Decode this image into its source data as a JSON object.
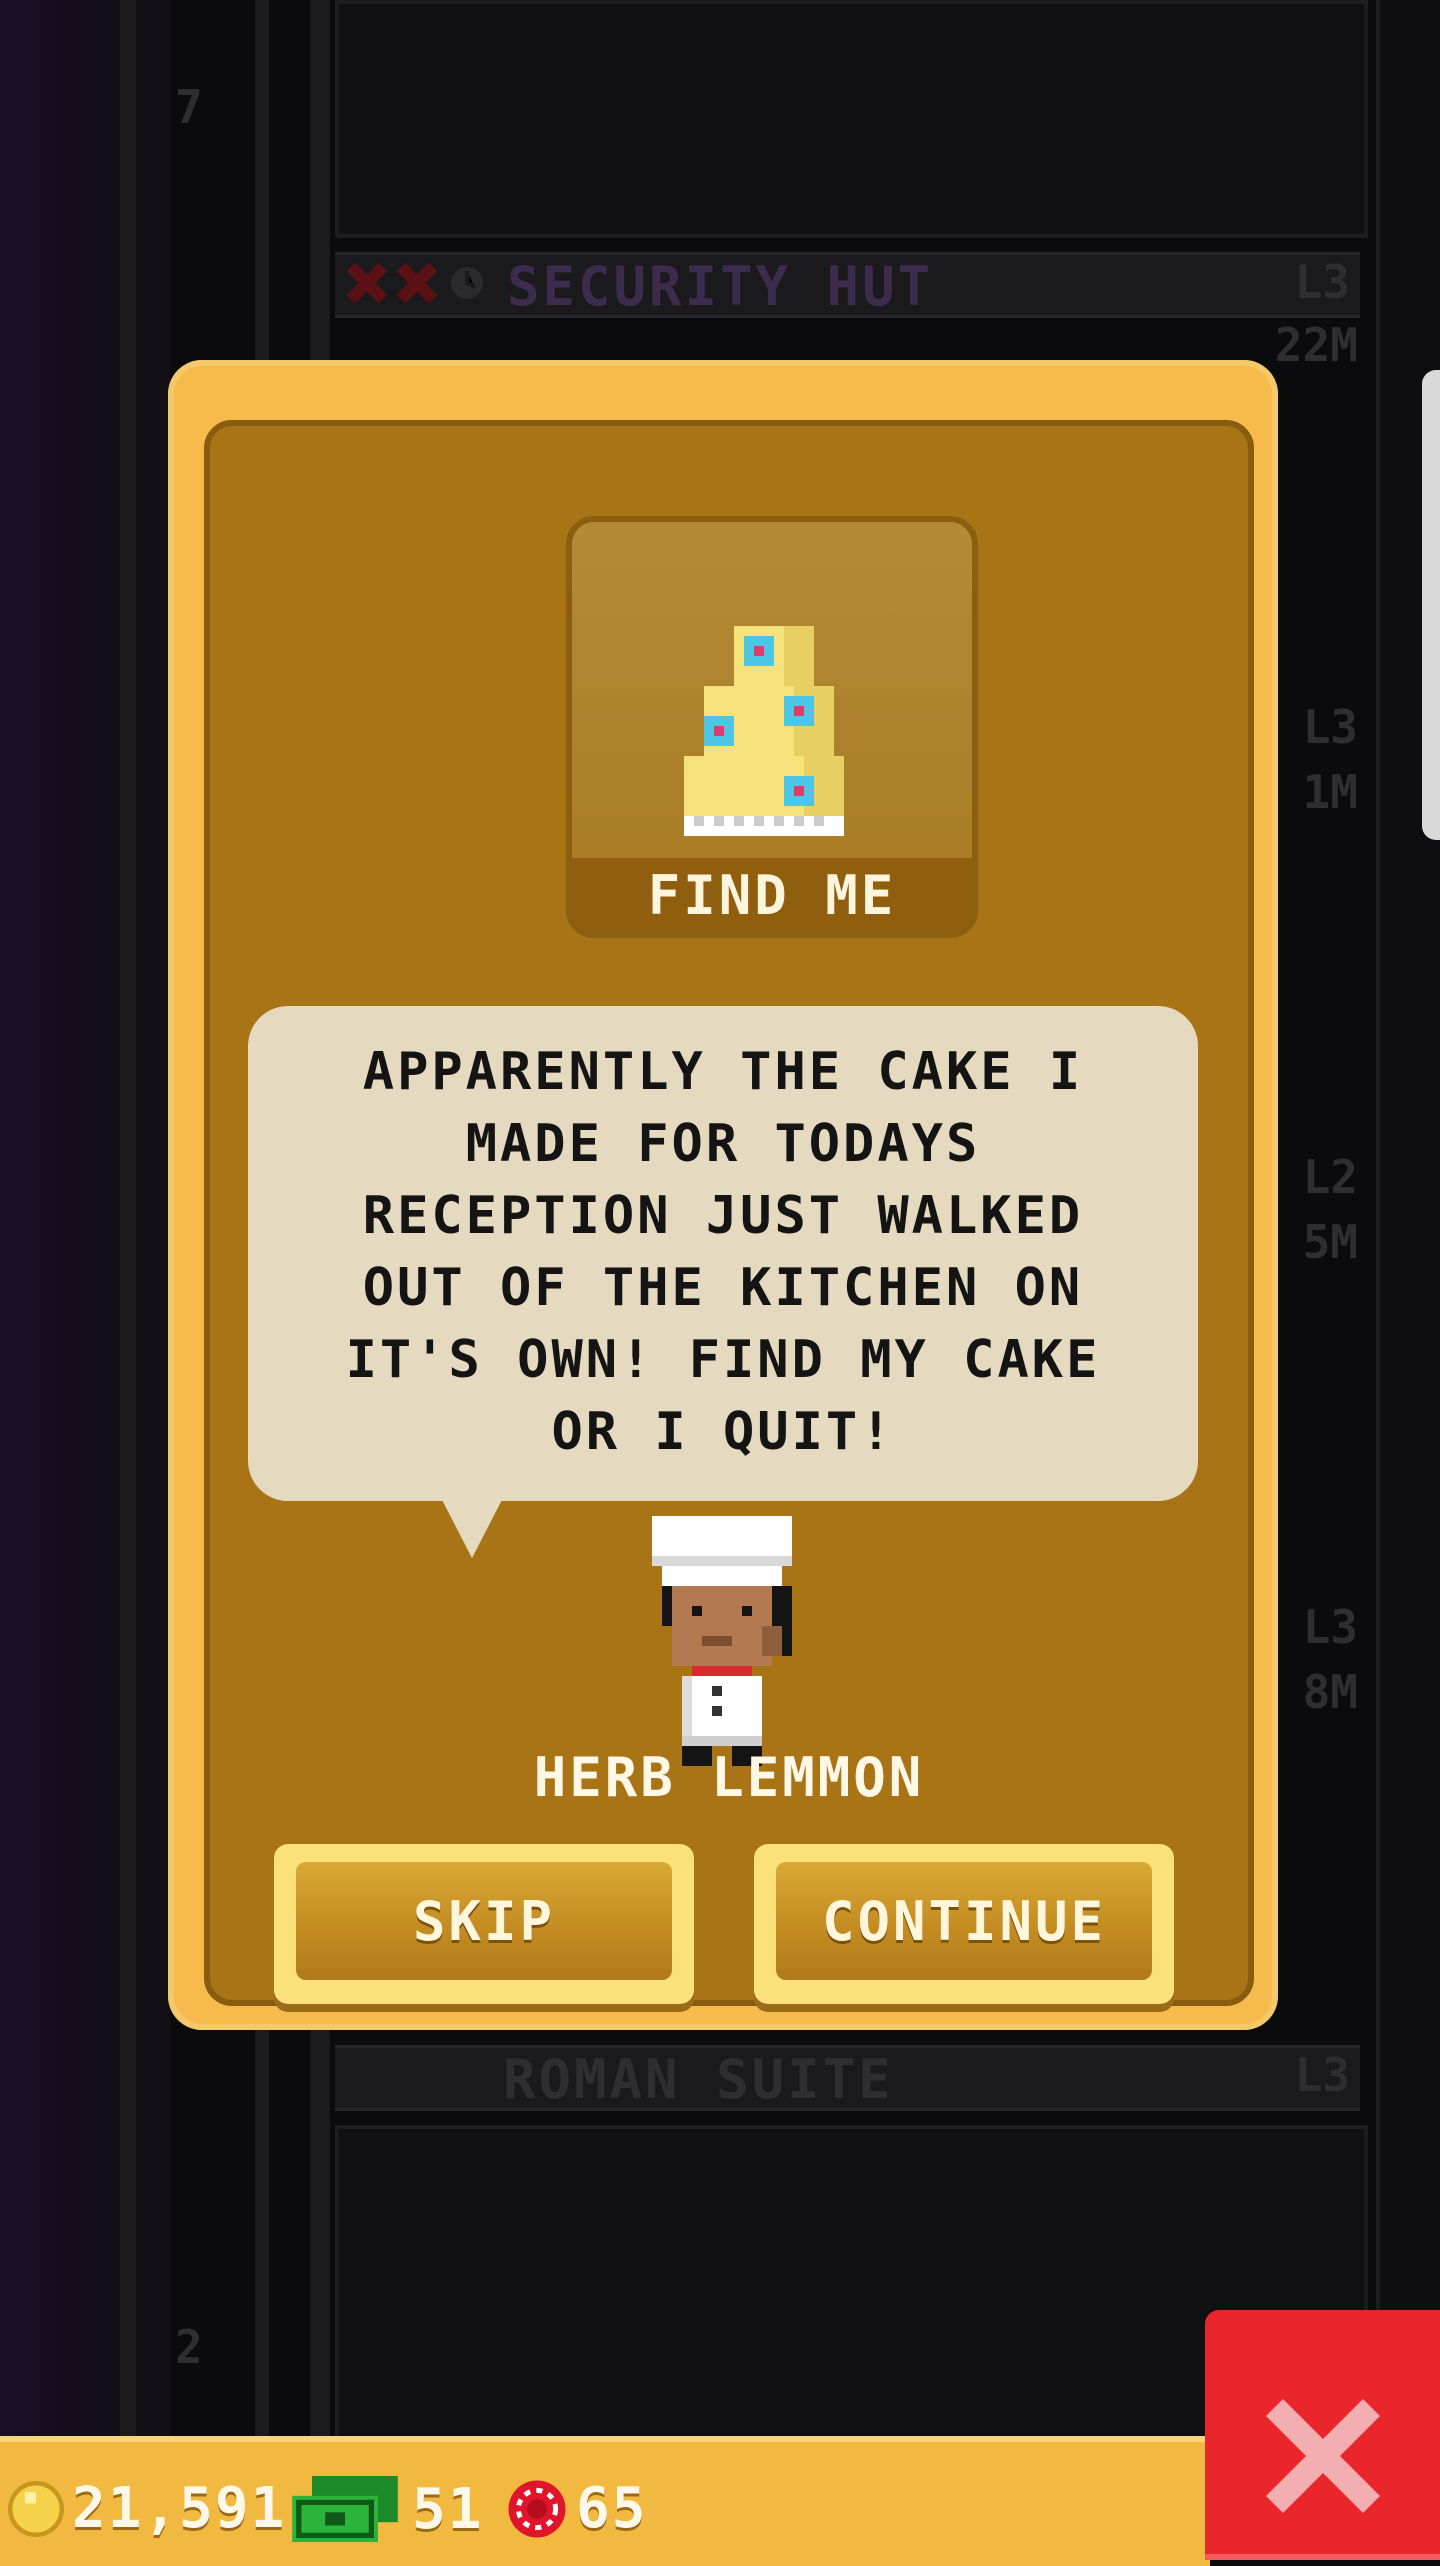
{
  "tower": {
    "floor_top": "7",
    "floor_bottom": "2",
    "room_top": {
      "name": "SECURITY HUT",
      "level": "L3",
      "value": "22M"
    },
    "room_bottom": {
      "name": "ROMAN SUITE",
      "level": "L3"
    },
    "side_levels": [
      {
        "level": "L3",
        "value": "1M"
      },
      {
        "level": "L2",
        "value": "5M"
      },
      {
        "level": "L3",
        "value": "8M"
      }
    ]
  },
  "mission": {
    "reward_label": "FIND ME",
    "reward_icon": "cake-icon",
    "dialogue": "APPARENTLY THE CAKE I MADE FOR TODAYS RECEPTION JUST WALKED OUT OF THE KITCHEN ON IT'S OWN! FIND MY CAKE OR I QUIT!",
    "npc_name": "HERB LEMMON",
    "skip_label": "SKIP",
    "continue_label": "CONTINUE"
  },
  "hud": {
    "coins": "21,591",
    "bux": "51",
    "gems": "65"
  },
  "colors": {
    "modal": "#f6bb4c",
    "panel": "#a87415",
    "bubble": "#e5d9bf",
    "close": "#e8262b"
  }
}
